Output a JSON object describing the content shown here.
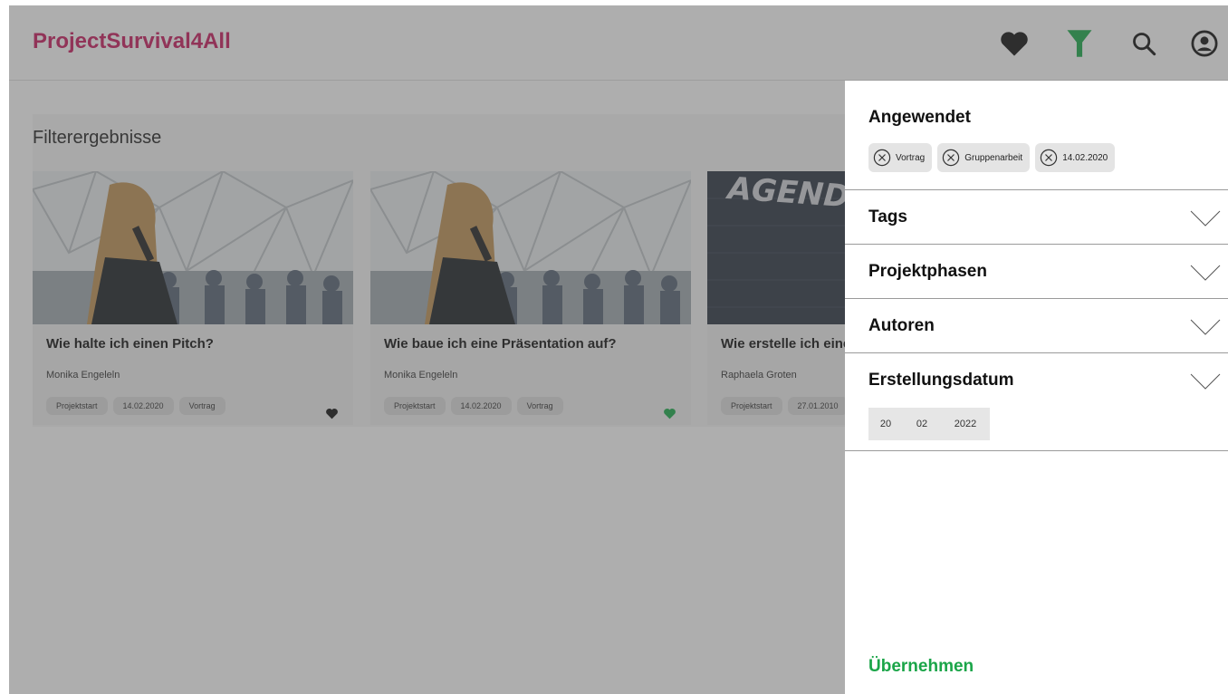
{
  "header": {
    "logo": "ProjectSurvival4All",
    "icons": [
      "heart-icon",
      "filter-icon",
      "search-icon",
      "account-icon"
    ],
    "filter_active_color": "#1aa548"
  },
  "results": {
    "title": "Filterergebnisse",
    "cards": [
      {
        "title": "Wie halte ich einen Pitch?",
        "author": "Monika Engeleln",
        "tags": [
          "Projektstart",
          "14.02.2020",
          "Vortrag"
        ],
        "favorite": "black"
      },
      {
        "title": "Wie baue ich eine Präsentation auf?",
        "author": "Monika Engeleln",
        "tags": [
          "Projektstart",
          "14.02.2020",
          "Vortrag"
        ],
        "favorite": "green"
      },
      {
        "title": "Wie erstelle ich eine",
        "author": "Raphaela Groten",
        "tags": [
          "Projektstart",
          "27.01.2010"
        ],
        "image_text": "AGENDA"
      }
    ]
  },
  "filter": {
    "applied_title": "Angewendet",
    "applied_chips": [
      "Vortrag",
      "Gruppenarbeit",
      "14.02.2020"
    ],
    "sections": [
      "Tags",
      "Projektphasen",
      "Autoren",
      "Erstellungsdatum"
    ],
    "date": {
      "day": "20",
      "month": "02",
      "year": "2022"
    },
    "apply_label": "Übernehmen"
  },
  "colors": {
    "brand": "#c01b5b",
    "accent_green": "#1aa548"
  }
}
